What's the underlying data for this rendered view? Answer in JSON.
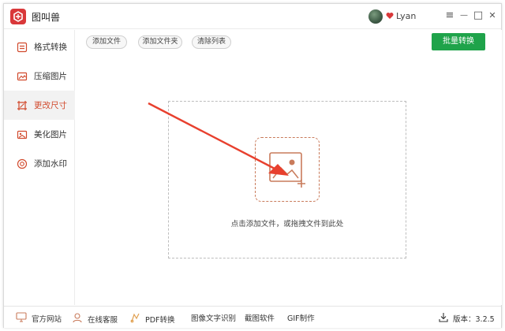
{
  "app": {
    "title": "图叫兽"
  },
  "user": {
    "name": "Lyan"
  },
  "window_controls": {
    "menu": "≡",
    "minimize": "—",
    "maximize": "□",
    "close": "✕"
  },
  "sidebar": {
    "items": [
      {
        "label": "格式转换",
        "icon": "format-convert-icon"
      },
      {
        "label": "压缩图片",
        "icon": "compress-icon"
      },
      {
        "label": "更改尺寸",
        "icon": "resize-icon",
        "active": true
      },
      {
        "label": "美化图片",
        "icon": "beautify-icon"
      },
      {
        "label": "添加水印",
        "icon": "watermark-icon"
      }
    ]
  },
  "toolbar": {
    "add_file": "添加文件",
    "add_folder": "添加文件夹",
    "clear_list": "清除列表",
    "batch_convert": "批量转换"
  },
  "main": {
    "drop_hint": "点击添加文件，或拖拽文件到此处"
  },
  "footer": {
    "website": "官方网站",
    "support": "在线客服",
    "pdf": "PDF转换",
    "ocr": "图像文字识别",
    "screenshot": "截图软件",
    "gif": "GIF制作",
    "version_label": "版本：3.2.5"
  },
  "colors": {
    "accent": "#d14a2d",
    "primary_button": "#1fa34a",
    "logo": "#d9383a",
    "arrow": "#e8402e"
  }
}
